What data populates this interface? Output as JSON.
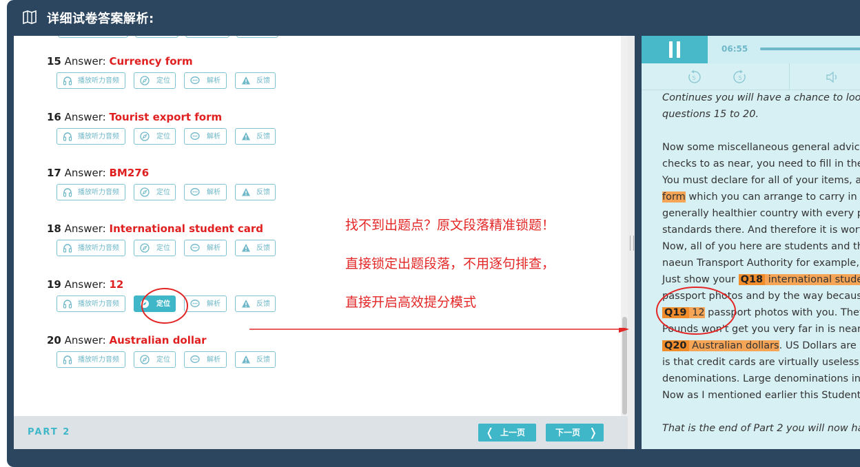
{
  "header": {
    "title": "详细试卷答案解析:",
    "icon": "book-icon"
  },
  "answers": [
    {
      "num": "15",
      "word": "Answer:",
      "value": "Currency form"
    },
    {
      "num": "16",
      "word": "Answer:",
      "value": "Tourist export form"
    },
    {
      "num": "17",
      "word": "Answer:",
      "value": "BM276"
    },
    {
      "num": "18",
      "word": "Answer:",
      "value": "International student card"
    },
    {
      "num": "19",
      "word": "Answer:",
      "value": "12",
      "active_button": "locate"
    },
    {
      "num": "20",
      "word": "Answer:",
      "value": "Australian dollar"
    }
  ],
  "buttons": {
    "play": "播放听力音频",
    "locate": "定位",
    "explain": "解析",
    "feedback": "反馈"
  },
  "annotations": {
    "line1": "找不到出题点？原文段落精准锁题！",
    "line2": "直接锁定出题段落，不用逐句排查，",
    "line3": "直接开启高效提分模式"
  },
  "footer": {
    "part": "PART 2",
    "prev": "上一页",
    "next": "下一页"
  },
  "player": {
    "time": "06:55",
    "rewind_label": "5",
    "forward_label": "5"
  },
  "transcript": {
    "l1": "Continues you will have a chance to look",
    "l2": "questions 15 to 20.",
    "l3": "Now some miscellaneous general advice",
    "l4": "checks to as near, you need to fill in the",
    "l5": "You must declare for all of your items, ar",
    "l6_hl": "form",
    "l6_rest": " which you can arrange to carry in a",
    "l7": "generally healthier country with every p",
    "l8": "standards there. And therefore it is wort",
    "l9": "Now, all of you here are students and th",
    "l10": "naeun Transport Authority for example,",
    "l11_pre": "Just show your ",
    "l11_tag": "Q18",
    "l11_hl": " international stude",
    "l12": "passport photos and by the way becaus",
    "l13_tag": "Q19",
    "l13_hl": " 12",
    "l13_rest": " passport photos with you. They",
    "l14": "Pounds won't get you very far in is near",
    "l15_tag": "Q20",
    "l15_hl": " Australian dollars",
    "l15_rest": ". US Dollars are",
    "l16": "is that credit cards are virtually useless,",
    "l17": "denominations. Large denominations inc",
    "l18": "Now as I mentioned earlier this Student",
    "l19": "That is the end of Part 2 you will now ha"
  },
  "colors": {
    "frame": "#2c4660",
    "accent": "#3fb7c9",
    "answer": "#e02020",
    "highlight": "#f6a455",
    "annotation": "#e32626"
  }
}
